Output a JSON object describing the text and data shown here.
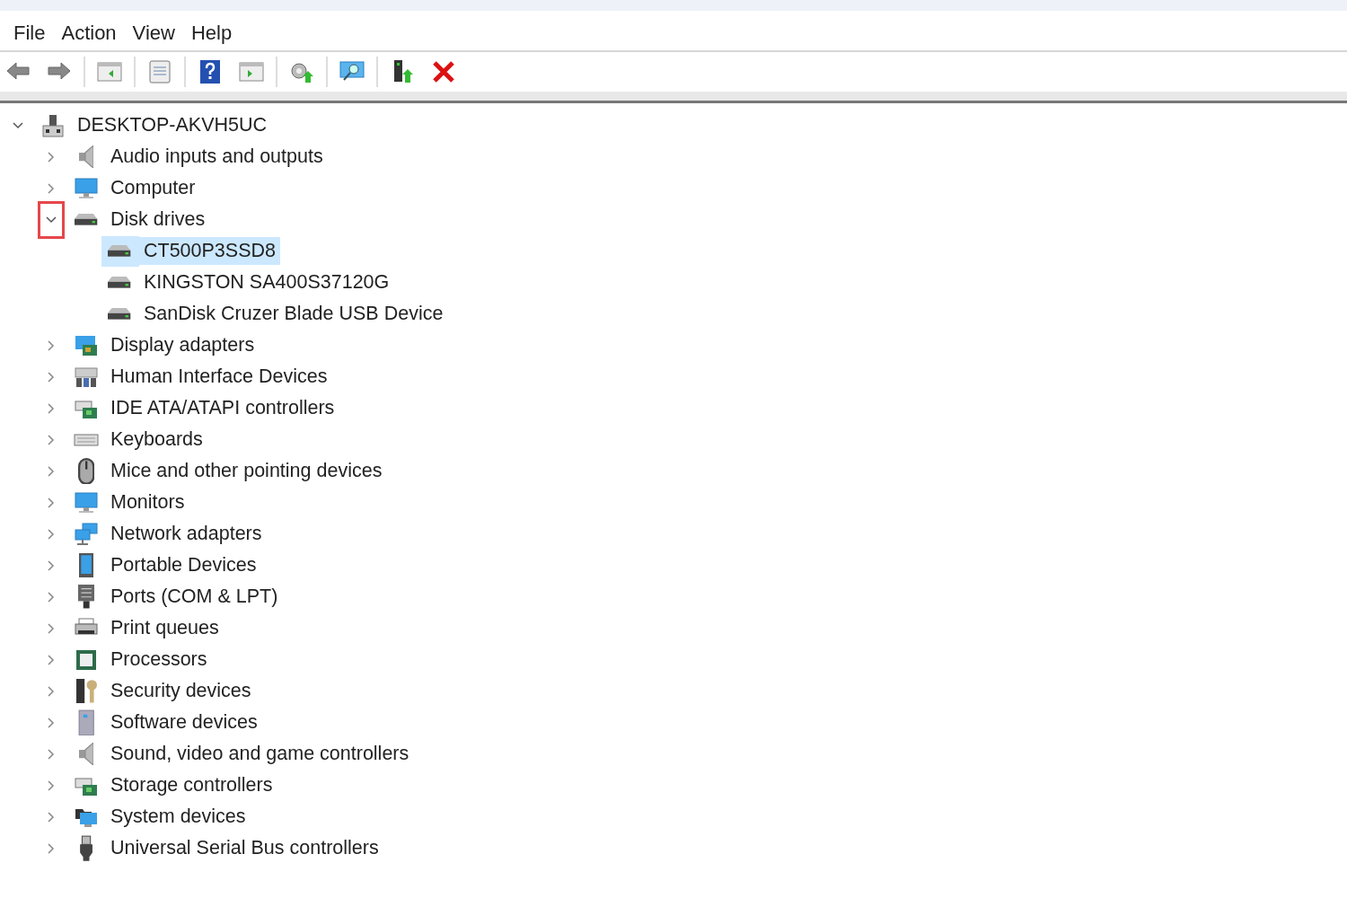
{
  "menu": [
    "File",
    "Action",
    "View",
    "Help"
  ],
  "tree": {
    "label": "DESKTOP-AKVH5UC",
    "kind": "computer-tower",
    "expanded": true,
    "selected": false,
    "children": [
      {
        "label": "Audio inputs and outputs",
        "kind": "speaker",
        "expanded": false,
        "selected": false
      },
      {
        "label": "Computer",
        "kind": "monitor",
        "expanded": false,
        "selected": false
      },
      {
        "label": "Disk drives",
        "kind": "drive",
        "expanded": true,
        "selected": false,
        "annotated": true,
        "children": [
          {
            "label": "CT500P3SSD8",
            "kind": "drive",
            "selected": true
          },
          {
            "label": "KINGSTON SA400S37120G",
            "kind": "drive",
            "selected": false
          },
          {
            "label": "SanDisk Cruzer Blade USB Device",
            "kind": "drive",
            "selected": false
          }
        ]
      },
      {
        "label": "Display adapters",
        "kind": "display-card",
        "expanded": false,
        "selected": false
      },
      {
        "label": "Human Interface Devices",
        "kind": "hid",
        "expanded": false,
        "selected": false
      },
      {
        "label": "IDE ATA/ATAPI controllers",
        "kind": "controller",
        "expanded": false,
        "selected": false
      },
      {
        "label": "Keyboards",
        "kind": "keyboard",
        "expanded": false,
        "selected": false
      },
      {
        "label": "Mice and other pointing devices",
        "kind": "mouse",
        "expanded": false,
        "selected": false
      },
      {
        "label": "Monitors",
        "kind": "monitor",
        "expanded": false,
        "selected": false
      },
      {
        "label": "Network adapters",
        "kind": "network",
        "expanded": false,
        "selected": false
      },
      {
        "label": "Portable Devices",
        "kind": "tablet",
        "expanded": false,
        "selected": false
      },
      {
        "label": "Ports (COM & LPT)",
        "kind": "port",
        "expanded": false,
        "selected": false
      },
      {
        "label": "Print queues",
        "kind": "printer",
        "expanded": false,
        "selected": false
      },
      {
        "label": "Processors",
        "kind": "chip",
        "expanded": false,
        "selected": false
      },
      {
        "label": "Security devices",
        "kind": "key",
        "expanded": false,
        "selected": false
      },
      {
        "label": "Software devices",
        "kind": "box",
        "expanded": false,
        "selected": false
      },
      {
        "label": "Sound, video and game controllers",
        "kind": "speaker",
        "expanded": false,
        "selected": false
      },
      {
        "label": "Storage controllers",
        "kind": "controller",
        "expanded": false,
        "selected": false
      },
      {
        "label": "System devices",
        "kind": "folder-monitor",
        "expanded": false,
        "selected": false
      },
      {
        "label": "Universal Serial Bus controllers",
        "kind": "usb",
        "expanded": false,
        "selected": false
      }
    ]
  }
}
